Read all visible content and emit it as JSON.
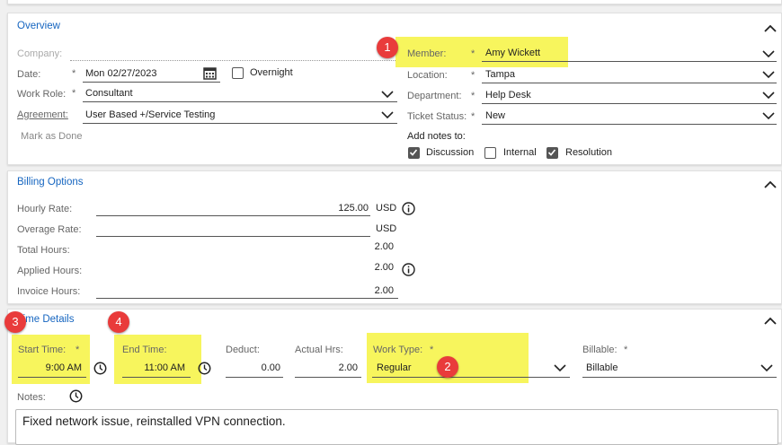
{
  "overview": {
    "title": "Overview",
    "company_label": "Company:",
    "date_label": "Date:",
    "date_value": "Mon 02/27/2023",
    "overnight_label": "Overnight",
    "work_role_label": "Work Role:",
    "work_role_value": "Consultant",
    "agreement_label": "Agreement:",
    "agreement_value": "User Based +/Service Testing",
    "mark_as_done": "Mark as Done",
    "member_label": "Member:",
    "member_value": "Amy Wickett",
    "location_label": "Location:",
    "location_value": "Tampa",
    "department_label": "Department:",
    "department_value": "Help Desk",
    "ticket_status_label": "Ticket Status:",
    "ticket_status_value": "New",
    "add_notes_label": "Add notes to:",
    "notes_targets": [
      {
        "label": "Discussion",
        "checked": true
      },
      {
        "label": "Internal",
        "checked": false
      },
      {
        "label": "Resolution",
        "checked": true
      }
    ],
    "required_mark": "*"
  },
  "billing": {
    "title": "Billing Options",
    "hourly_rate_label": "Hourly Rate:",
    "hourly_rate_value": "125.00",
    "hourly_currency": "USD",
    "overage_rate_label": "Overage Rate:",
    "overage_currency": "USD",
    "total_hours_label": "Total Hours:",
    "total_hours_value": "2.00",
    "applied_hours_label": "Applied Hours:",
    "applied_hours_value": "2.00",
    "invoice_hours_label": "Invoice Hours:",
    "invoice_hours_value": "2.00"
  },
  "time_details": {
    "title": "Time Details",
    "start_time_label": "Start Time:",
    "start_time_value": "9:00 AM",
    "end_time_label": "End Time:",
    "end_time_value": "11:00 AM",
    "deduct_label": "Deduct:",
    "deduct_value": "0.00",
    "actual_hrs_label": "Actual Hrs:",
    "actual_hrs_value": "2.00",
    "work_type_label": "Work Type:",
    "work_type_value": "Regular",
    "billable_label": "Billable:",
    "billable_value": "Billable",
    "notes_label": "Notes:",
    "notes_value": "Fixed network issue, reinstalled VPN connection."
  },
  "callouts": [
    "1",
    "2",
    "3",
    "4"
  ],
  "colors": {
    "accent": "#1565c0",
    "highlight": "#f7f55d",
    "callout": "#e93b3b"
  }
}
